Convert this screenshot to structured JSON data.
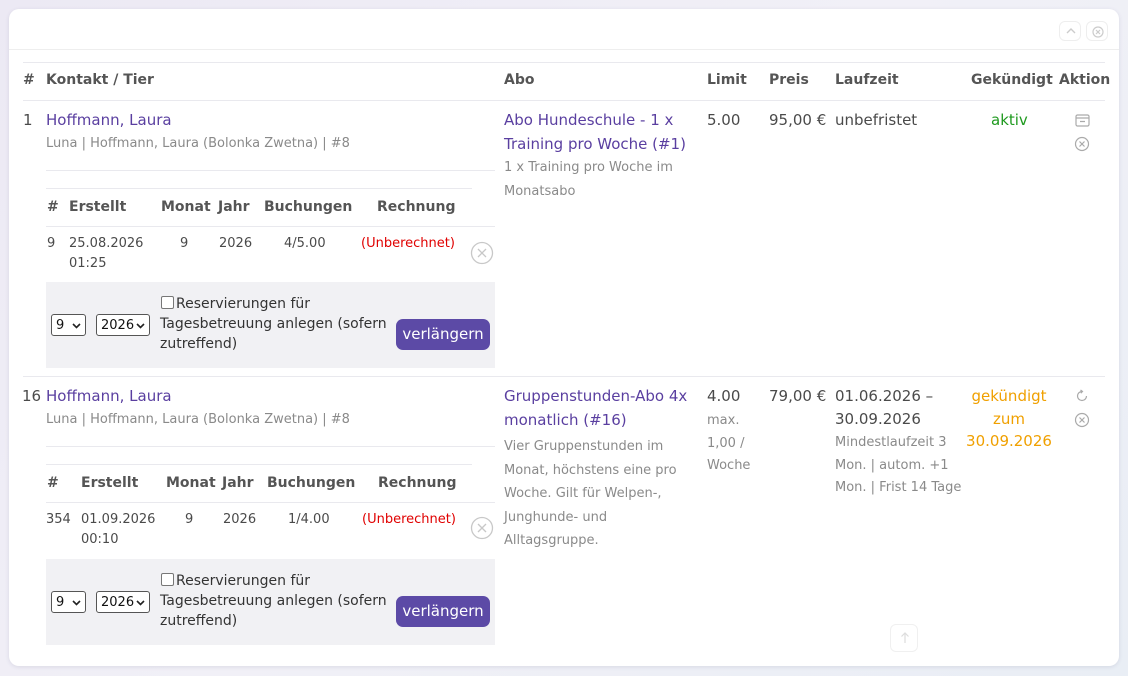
{
  "table": {
    "headers": {
      "num": "#",
      "contact": "Kontakt / Tier",
      "abo": "Abo",
      "limit": "Limit",
      "price": "Preis",
      "duration": "Laufzeit",
      "cancelled": "Gekündigt",
      "action": "Aktion"
    },
    "rows": [
      {
        "num": "1",
        "contact_name": "Hoffmann, Laura",
        "contact_sub": "Luna | Hoffmann, Laura (Bolonka Zwetna) | #8",
        "abo_title_1": "Abo Hundeschule - 1 x",
        "abo_title_2": "Training pro Woche (#1)",
        "abo_desc_1": "1 x Training pro Woche im",
        "abo_desc_2": "Monatsabo",
        "limit": "5.00",
        "price": "95,00 €",
        "duration": "unbefristet",
        "status": "aktiv",
        "sub_headers": {
          "num": "#",
          "created": "Erstellt",
          "month": "Monat",
          "year": "Jahr",
          "bookings": "Buchungen",
          "invoice": "Rechnung"
        },
        "sub_row": {
          "num": "9",
          "date": "25.08.2026",
          "time": "01:25",
          "month": "9",
          "year": "2026",
          "bookings": "4/5.00",
          "invoice": "(Unberechnet)"
        },
        "extend": {
          "month": "9",
          "year": "2026",
          "checkbox_label": "Reservierungen für Tagesbetreuung anlegen (sofern zutreffend)",
          "button": "verlängern"
        }
      },
      {
        "num": "16",
        "contact_name": "Hoffmann, Laura",
        "contact_sub": "Luna | Hoffmann, Laura (Bolonka Zwetna) | #8",
        "abo_title_1": "Gruppenstunden-Abo 4x",
        "abo_title_2": "monatlich (#16)",
        "abo_desc": "Vier Gruppenstunden im Monat, höchstens eine pro Woche. Gilt für Welpen-, Junghunde- und Alltagsgruppe.",
        "limit": "4.00",
        "limit_note": "max. 1,00 / Woche",
        "price": "79,00 €",
        "duration_1": "01.06.2026 –",
        "duration_2": "30.09.2026",
        "duration_note": "Mindestlaufzeit 3 Mon. | autom. +1 Mon. | Frist 14 Tage",
        "status_1": "gekündigt",
        "status_2": "zum",
        "status_3": "30.09.2026",
        "sub_headers": {
          "num": "#",
          "created": "Erstellt",
          "month": "Monat",
          "year": "Jahr",
          "bookings": "Buchungen",
          "invoice": "Rechnung"
        },
        "sub_row": {
          "num": "354",
          "date": "01.09.2026",
          "time": "00:10",
          "month": "9",
          "year": "2026",
          "bookings": "1/4.00",
          "invoice": "(Unberechnet)"
        },
        "extend": {
          "month": "9",
          "year": "2026",
          "checkbox_label": "Reservierungen für Tagesbetreuung anlegen (sofern zutreffend)",
          "button": "verlängern"
        }
      }
    ]
  },
  "colors": {
    "link": "#5a3fa0",
    "button": "#5c4aa6",
    "active": "#1f9a1f",
    "cancelled": "#f0a000",
    "unbilled": "#e00000"
  },
  "icons": [
    "chevron-up-icon",
    "close-circle-icon",
    "calendar-icon",
    "cancel-circle-icon",
    "refresh-icon",
    "scroll-top-icon"
  ]
}
